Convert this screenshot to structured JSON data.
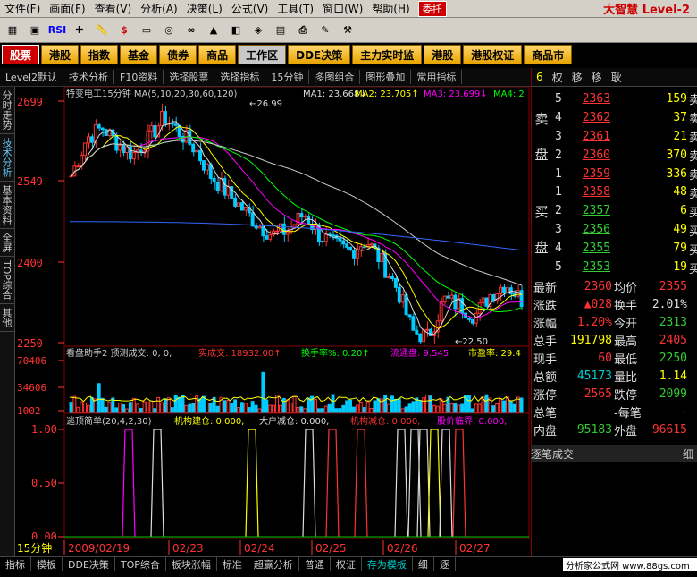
{
  "menu": [
    "文件(F)",
    "画面(F)",
    "查看(V)",
    "分析(A)",
    "决策(L)",
    "公式(V)",
    "工具(T)",
    "窗口(W)",
    "帮助(H)"
  ],
  "menu_entrust": "委托",
  "brand": "大智慧 Level-2",
  "toolbar_icons": [
    "grid-icon",
    "square-icon",
    "rsi-icon",
    "add-icon",
    "ruler-icon",
    "dollar-icon",
    "display-icon",
    "coins-icon",
    "binoculars-icon",
    "gold-icon",
    "chart-icon",
    "compass-icon",
    "folder-icon",
    "printer-icon",
    "edit-icon",
    "tools-icon"
  ],
  "toolbar_rsi": "RSI",
  "toolbar_dollar": "$",
  "tabs": [
    "股票",
    "港股",
    "指数",
    "基金",
    "债券",
    "商品",
    "工作区",
    "DDE决策",
    "主力实时监",
    "港股",
    "港股权证",
    "商品市"
  ],
  "subtb": [
    "Level2默认",
    "技术分析",
    "F10资料",
    "选择股票",
    "选择指标",
    "15分钟",
    "多图组合",
    "图形叠加",
    "常用指标"
  ],
  "rp_head": [
    "6",
    "权",
    "移",
    "移",
    "耿"
  ],
  "leftbar": [
    "分时走势",
    "技术分析",
    "基本资料",
    "全屏",
    "TOP综合",
    "其他"
  ],
  "chart": {
    "title": "特变电工15分钟 MA(5,10,20,30,60,120)",
    "ma1": "MA1: 23.668↓",
    "ma2": "MA2: 23.705↑",
    "ma3": "MA3: 23.699↓",
    "ma4": "MA4: 2",
    "price_high_label": "26.99",
    "price_low_label": "22.50",
    "y_ticks": [
      "2699",
      "2549",
      "2400",
      "2250"
    ],
    "vol_title": "看盘助手2 预测成交: 0, 0,",
    "vol_actual": "实成交: 18932.00↑",
    "vol_turn": "换手率%: 0.20↑",
    "vol_float": "流通盘: 9.545",
    "vol_pe": "市盈率: 29.4",
    "vol_ticks": [
      "70406",
      "34606",
      "1002"
    ],
    "ind_title": "逃顶简单(20,4,2,30)",
    "ind_a": "机构建仓: 0.000,",
    "ind_b": "大户减仓: 0.000,",
    "ind_c": "机构减仓: 0.000,",
    "ind_d": "股价临界: 0.000,",
    "ind_ticks": [
      "1.00",
      "0.50",
      "0.00"
    ],
    "period": "15分钟",
    "dates": [
      "2009/02/19",
      "02/23",
      "02/24",
      "02/25",
      "02/26",
      "02/27"
    ]
  },
  "orderbook": {
    "sell_label": [
      "卖",
      "盘"
    ],
    "buy_label": [
      "买",
      "盘"
    ],
    "sell": [
      {
        "lvl": "5",
        "px": "2363",
        "vol": "159"
      },
      {
        "lvl": "4",
        "px": "2362",
        "vol": "37"
      },
      {
        "lvl": "3",
        "px": "2361",
        "vol": "21"
      },
      {
        "lvl": "2",
        "px": "2360",
        "vol": "370"
      },
      {
        "lvl": "1",
        "px": "2359",
        "vol": "336"
      }
    ],
    "buy": [
      {
        "lvl": "1",
        "px": "2358",
        "vol": "48"
      },
      {
        "lvl": "2",
        "px": "2357",
        "vol": "6"
      },
      {
        "lvl": "3",
        "px": "2356",
        "vol": "49"
      },
      {
        "lvl": "4",
        "px": "2355",
        "vol": "79"
      },
      {
        "lvl": "5",
        "px": "2353",
        "vol": "19"
      }
    ],
    "right_edge": [
      "卖",
      "卖",
      "卖",
      "卖",
      "卖",
      "卖",
      "买",
      "买",
      "买",
      "买"
    ]
  },
  "stats": [
    {
      "k": "最新",
      "v": "2360",
      "vc": "red",
      "k2": "均价",
      "v2": "2355",
      "v2c": "red"
    },
    {
      "k": "涨跌",
      "v": "▲028",
      "vc": "red",
      "k2": "换手",
      "v2": "2.01%",
      "v2c": "wht"
    },
    {
      "k": "涨幅",
      "v": "1.20%",
      "vc": "red",
      "k2": "今开",
      "v2": "2313",
      "v2c": "grn"
    },
    {
      "k": "总手",
      "v": "191798",
      "vc": "yel",
      "k2": "最高",
      "v2": "2405",
      "v2c": "red"
    },
    {
      "k": "现手",
      "v": "60",
      "vc": "red",
      "k2": "最低",
      "v2": "2250",
      "v2c": "grn"
    },
    {
      "k": "总额",
      "v": "45173",
      "vc": "cyn",
      "k2": "量比",
      "v2": "1.14",
      "v2c": "yel"
    },
    {
      "k": "涨停",
      "v": "2565",
      "vc": "red",
      "k2": "跌停",
      "v2": "2099",
      "v2c": "grn"
    },
    {
      "k": "总笔",
      "v": "",
      "vc": "wht",
      "k2": "-每笔",
      "v2": "-",
      "v2c": "wht"
    },
    {
      "k": "内盘",
      "v": "95183",
      "vc": "grn",
      "k2": "外盘",
      "v2": "96615",
      "v2c": "red"
    }
  ],
  "ztb": "逐笔成交",
  "ztb_small": "细",
  "bottombar": [
    "指标",
    "模板",
    "DDE决策",
    "TOP综合",
    "板块涨幅",
    "标准",
    "超赢分析",
    "普通",
    "权证",
    "存为模板",
    "细",
    "逐"
  ],
  "site": "分析家公式网 www.88gs.com"
}
